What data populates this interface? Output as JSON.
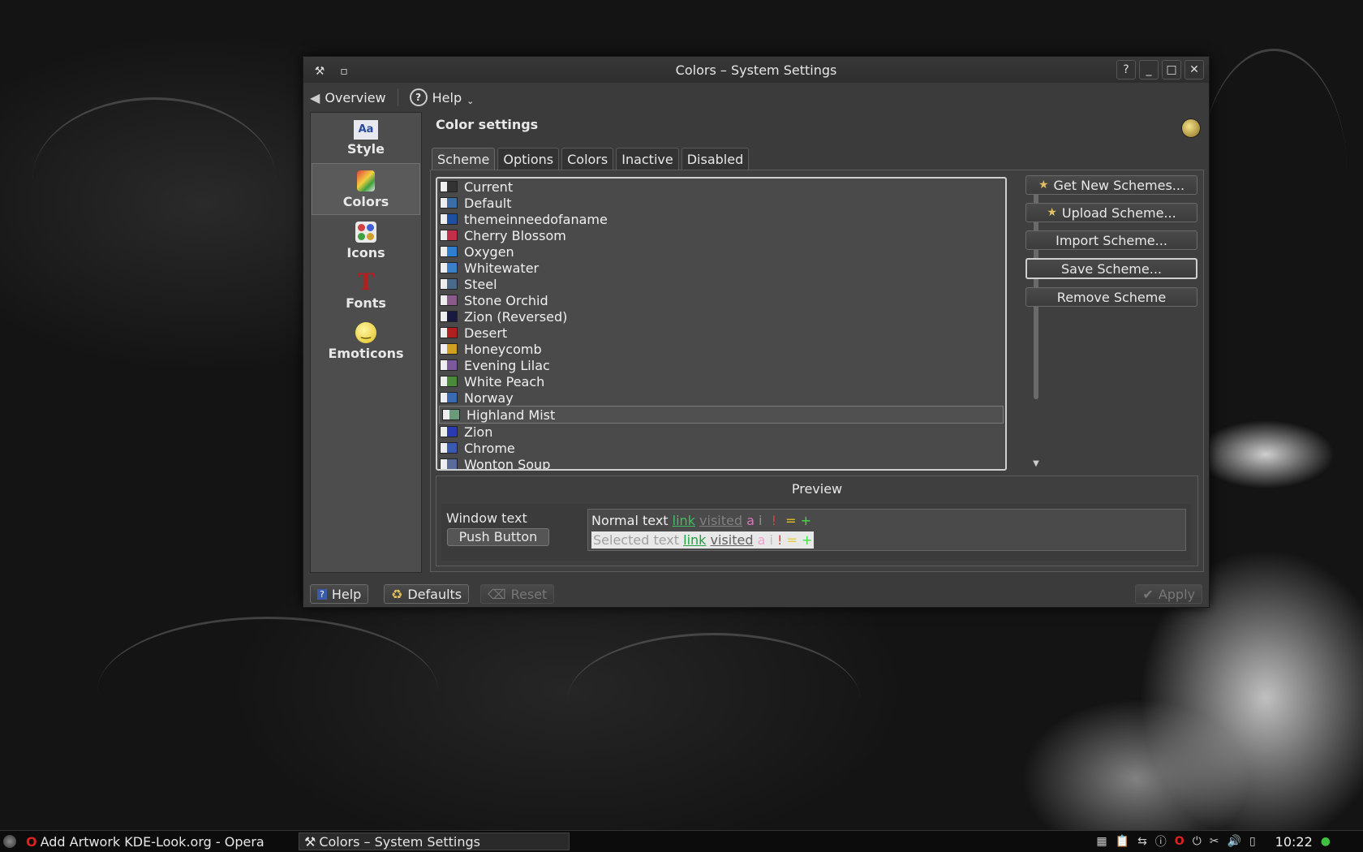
{
  "window": {
    "title": "Colors – System Settings"
  },
  "toolbar": {
    "overview": "Overview",
    "help": "Help"
  },
  "sidebar": {
    "items": [
      {
        "label": "Style",
        "icon": "style-icon"
      },
      {
        "label": "Colors",
        "icon": "colors-icon",
        "selected": true
      },
      {
        "label": "Icons",
        "icon": "icons-icon"
      },
      {
        "label": "Fonts",
        "icon": "fonts-icon"
      },
      {
        "label": "Emoticons",
        "icon": "emoticons-icon"
      }
    ]
  },
  "main": {
    "heading": "Color settings",
    "tabs": [
      "Scheme",
      "Options",
      "Colors",
      "Inactive",
      "Disabled"
    ],
    "selected_tab": "Scheme",
    "schemes": [
      {
        "name": "Current",
        "color": "#333333"
      },
      {
        "name": "Default",
        "color": "#3a6ea5"
      },
      {
        "name": "themeinneedofaname",
        "color": "#1e4fa0"
      },
      {
        "name": "Cherry Blossom",
        "color": "#c0304a"
      },
      {
        "name": "Oxygen",
        "color": "#2f7fd0"
      },
      {
        "name": "Whitewater",
        "color": "#3a7fc8"
      },
      {
        "name": "Steel",
        "color": "#4a6a8a"
      },
      {
        "name": "Stone Orchid",
        "color": "#8a5a8a"
      },
      {
        "name": "Zion (Reversed)",
        "color": "#1a1a40"
      },
      {
        "name": "Desert",
        "color": "#b02020"
      },
      {
        "name": "Honeycomb",
        "color": "#d0a020"
      },
      {
        "name": "Evening Lilac",
        "color": "#7a5a9a"
      },
      {
        "name": "White Peach",
        "color": "#4a8a3a"
      },
      {
        "name": "Norway",
        "color": "#3a6ab0"
      },
      {
        "name": "Highland Mist",
        "color": "#6a9a7a"
      },
      {
        "name": "Zion",
        "color": "#2a3ab0"
      },
      {
        "name": "Chrome",
        "color": "#3a5ab0"
      },
      {
        "name": "Wonton Soup",
        "color": "#5a6a9a"
      }
    ],
    "highlighted_scheme": "Highland Mist",
    "buttons": {
      "get_new": "Get New Schemes...",
      "upload": "Upload Scheme...",
      "import": "Import Scheme...",
      "save": "Save Scheme...",
      "remove": "Remove Scheme"
    },
    "preview": {
      "title": "Preview",
      "window_text": "Window text",
      "push_button": "Push Button",
      "normal_text": "Normal text",
      "link": "link",
      "visited": "visited",
      "selected_text": "Selected text",
      "a": "a",
      "i": "i",
      "excl": "!",
      "eq": "=",
      "plus": "+"
    }
  },
  "bottom": {
    "help": "Help",
    "defaults": "Defaults",
    "reset": "Reset",
    "apply": "Apply"
  },
  "taskbar": {
    "tasks": [
      "Add Artwork KDE-Look.org - Opera",
      "Colors – System Settings"
    ],
    "clock": "10:22"
  }
}
